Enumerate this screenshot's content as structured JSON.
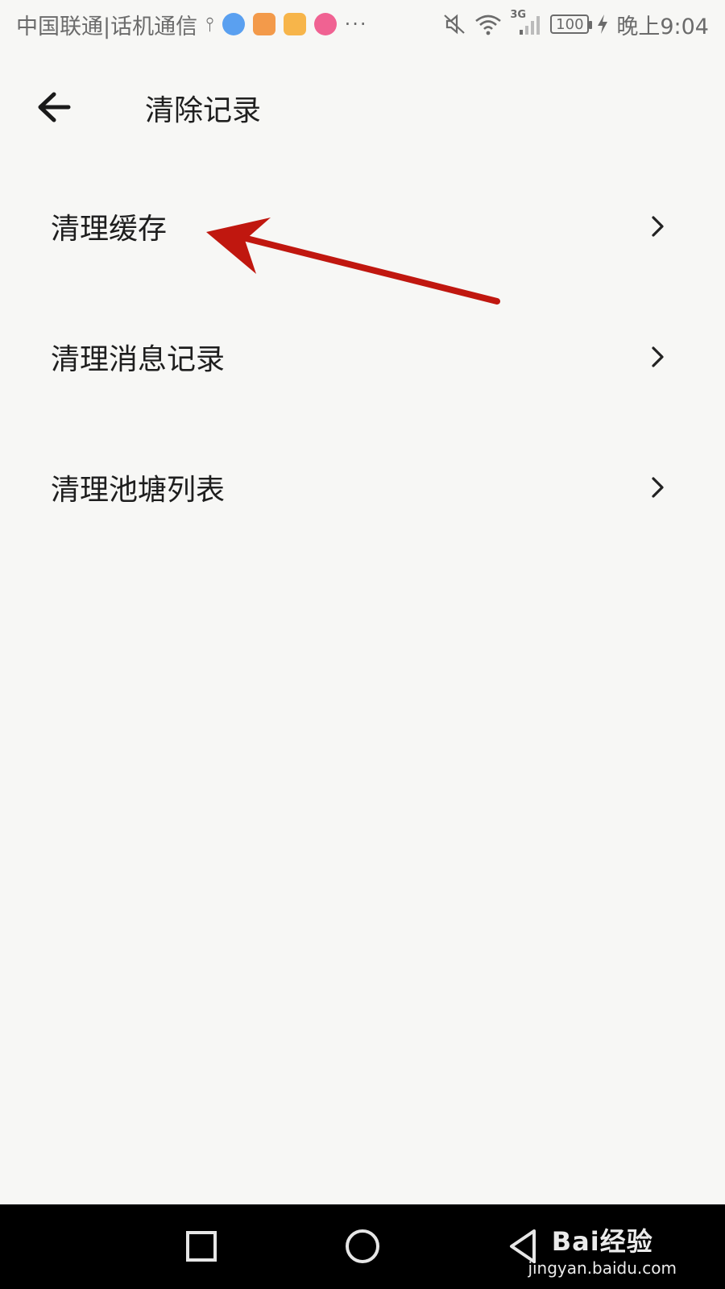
{
  "status_bar": {
    "carrier": "中国联通|话机通信",
    "dots": "···",
    "network": "3G",
    "battery": "100",
    "time": "晚上9:04",
    "app_icon_colors": [
      "#5aa0f0",
      "#f39a4a",
      "#f7b54a",
      "#f06292"
    ]
  },
  "header": {
    "back_icon": "arrow-left-icon",
    "title": "清除记录"
  },
  "menu": {
    "items": [
      {
        "label": "清理缓存",
        "icon": "chevron-right-icon"
      },
      {
        "label": "清理消息记录",
        "icon": "chevron-right-icon"
      },
      {
        "label": "清理池塘列表",
        "icon": "chevron-right-icon"
      }
    ]
  },
  "annotation": {
    "color": "#c0170f",
    "target": "清理缓存"
  },
  "navbar": {
    "recent_icon": "square-icon",
    "home_icon": "circle-icon",
    "back_icon": "triangle-back-icon"
  },
  "watermark": {
    "brand": "Bai经验",
    "url": "jingyan.baidu.com"
  }
}
